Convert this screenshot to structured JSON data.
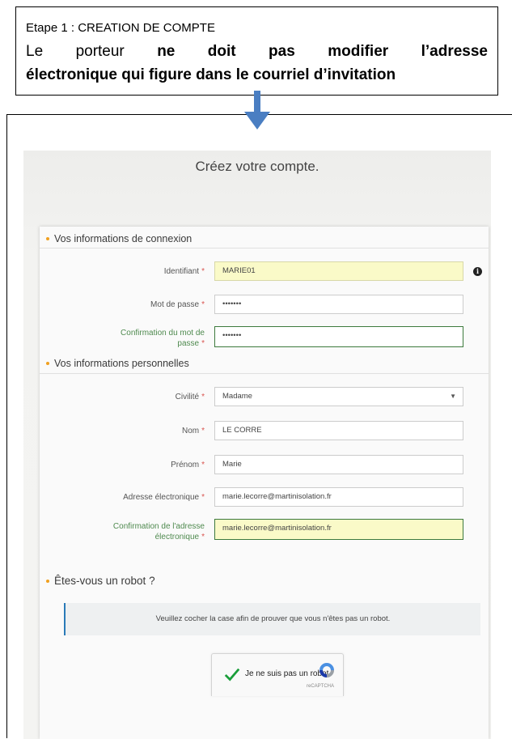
{
  "note": {
    "step": "Etape 1 : CREATION DE COMPTE",
    "line1_word1": "Le",
    "line1_word2": "porteur",
    "line1_bold": [
      "ne",
      "doit",
      "pas",
      "modifier",
      "l’adresse"
    ],
    "line2_bold": "électronique qui figure dans le courriel d’invitation"
  },
  "page": {
    "title": "Créez votre compte."
  },
  "sections": {
    "connexion": "Vos informations de connexion",
    "personnelles": "Vos informations personnelles",
    "robot": "Êtes-vous un robot ?"
  },
  "fields": {
    "identifiant": {
      "label": "Identifiant",
      "value": "MARIE01"
    },
    "password": {
      "label": "Mot de passe",
      "value": "•••••••"
    },
    "password_confirm": {
      "label_line1": "Confirmation du mot de",
      "label_line2": "passe",
      "value": "•••••••"
    },
    "civilite": {
      "label": "Civilité",
      "value": "Madame"
    },
    "nom": {
      "label": "Nom",
      "value": "LE CORRE"
    },
    "prenom": {
      "label": "Prénom",
      "value": "Marie"
    },
    "email": {
      "label": "Adresse électronique",
      "value": "marie.lecorre@martinisolation.fr"
    },
    "email_confirm": {
      "label_line1": "Confirmation de l'adresse",
      "label_line2": "électronique",
      "value": "marie.lecorre@martinisolation.fr"
    }
  },
  "required_mark": "*",
  "info_icon_glyph": "i",
  "robot_message": "Veuillez cocher la case afin de prouver que vous n'êtes pas un robot.",
  "captcha": {
    "label": "Je ne suis pas un robot",
    "brand": "reCAPTCHA"
  },
  "colors": {
    "accent_dot": "#f0a020",
    "required": "#d9534f",
    "highlight_field": "#fafac8",
    "arrow": "#4a7ec2",
    "info_bar": "#2a7ab8"
  }
}
